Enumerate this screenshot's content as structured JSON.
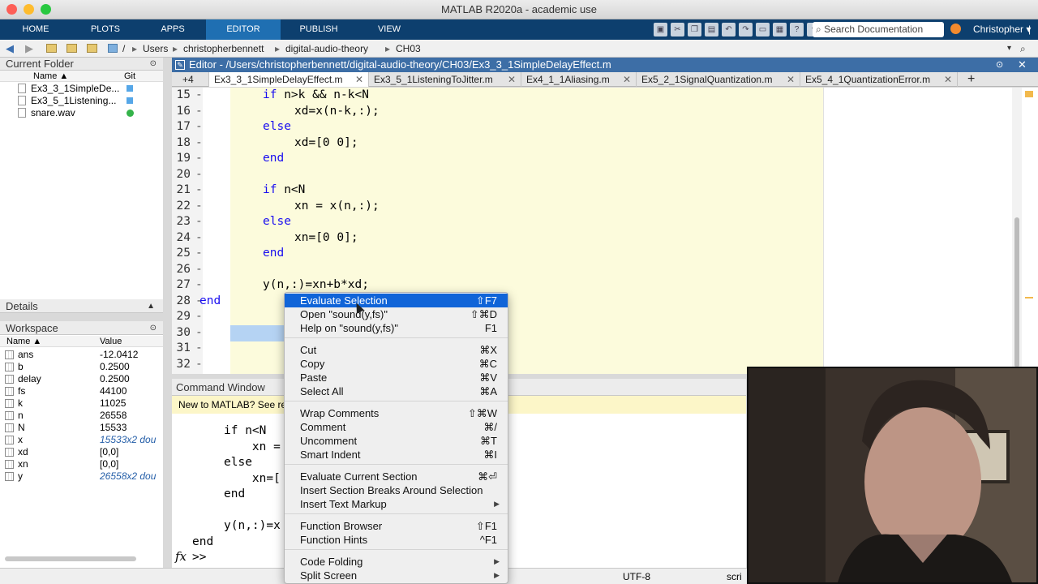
{
  "window": {
    "title": "MATLAB R2020a - academic use"
  },
  "ribbon": {
    "tabs": [
      {
        "label": "HOME"
      },
      {
        "label": "PLOTS"
      },
      {
        "label": "APPS"
      },
      {
        "label": "EDITOR"
      },
      {
        "label": "PUBLISH"
      },
      {
        "label": "VIEW"
      }
    ],
    "search_placeholder": "Search Documentation",
    "user": "Christopher",
    "active_tab": "EDITOR",
    "accent_color": "#0d3f6e"
  },
  "address": {
    "root": "/",
    "crumbs": [
      "Users",
      "christopherbennett",
      "digital-audio-theory",
      "CH03"
    ]
  },
  "current_folder": {
    "title": "Current Folder",
    "col_name": "Name ▲",
    "col_git": "Git",
    "files": [
      {
        "name": "Ex3_3_1SimpleDe..."
      },
      {
        "name": "Ex3_5_1Listening..."
      },
      {
        "name": "snare.wav"
      }
    ]
  },
  "details": {
    "title": "Details"
  },
  "workspace": {
    "title": "Workspace",
    "col_name": "Name ▲",
    "col_value": "Value",
    "vars": [
      {
        "name": "ans",
        "value": "-12.0412"
      },
      {
        "name": "b",
        "value": "0.2500"
      },
      {
        "name": "delay",
        "value": "0.2500"
      },
      {
        "name": "fs",
        "value": "44100"
      },
      {
        "name": "k",
        "value": "11025"
      },
      {
        "name": "n",
        "value": "26558"
      },
      {
        "name": "N",
        "value": "15533"
      },
      {
        "name": "x",
        "value": "15533x2 dou"
      },
      {
        "name": "xd",
        "value": "[0,0]"
      },
      {
        "name": "xn",
        "value": "[0,0]"
      },
      {
        "name": "y",
        "value": "26558x2 dou"
      }
    ]
  },
  "editor": {
    "title": "Editor - /Users/christopherbennett/digital-audio-theory/CH03/Ex3_3_1SimpleDelayEffect.m",
    "overflow": "+4",
    "tabs": [
      {
        "label": "Ex3_3_1SimpleDelayEffect.m"
      },
      {
        "label": "Ex3_5_1ListeningToJitter.m"
      },
      {
        "label": "Ex4_1_1Aliasing.m"
      },
      {
        "label": "Ex5_2_1SignalQuantization.m"
      },
      {
        "label": "Ex5_4_1QuantizationError.m"
      }
    ],
    "add": "+",
    "lines": [
      {
        "n": "15",
        "kw": "if",
        "rest": " n>k && n-k<N"
      },
      {
        "n": "16",
        "kw": "",
        "rest": "xd=x(n-k,:);"
      },
      {
        "n": "17",
        "kw": "else",
        "rest": ""
      },
      {
        "n": "18",
        "kw": "",
        "rest": "xd=[0 0];"
      },
      {
        "n": "19",
        "kw": "end",
        "rest": ""
      },
      {
        "n": "20",
        "kw": "",
        "rest": ""
      },
      {
        "n": "21",
        "kw": "if",
        "rest": " n<N"
      },
      {
        "n": "22",
        "kw": "",
        "rest": "xn = x(n,:);"
      },
      {
        "n": "23",
        "kw": "else",
        "rest": ""
      },
      {
        "n": "24",
        "kw": "",
        "rest": "xn=[0 0];"
      },
      {
        "n": "25",
        "kw": "end",
        "rest": ""
      },
      {
        "n": "26",
        "kw": "",
        "rest": ""
      },
      {
        "n": "27",
        "kw": "",
        "rest": "y(n,:)=xn+b*xd;"
      },
      {
        "n": "28",
        "kw": "end",
        "rest": ""
      },
      {
        "n": "29",
        "kw": "",
        "rest": ""
      },
      {
        "n": "30",
        "kw": "",
        "rest": "sound(y"
      },
      {
        "n": "31",
        "kw": "",
        "rest": ""
      },
      {
        "n": "32",
        "kw": "",
        "rest": ""
      }
    ]
  },
  "command_window": {
    "title": "Command Window",
    "new_msg": "New to MATLAB? See res",
    "lines": [
      "if n<N",
      "    xn =",
      "else",
      "    xn=[",
      "end",
      "",
      "y(n,:)=x",
      "end"
    ],
    "prompt": ">>"
  },
  "status": {
    "encoding": "UTF-8",
    "mode": "scri"
  },
  "context_menu": {
    "items": [
      {
        "label": "Evaluate Selection",
        "shortcut": "⇧F7"
      },
      {
        "label": "Open \"sound(y,fs)\"",
        "shortcut": "⇧⌘D"
      },
      {
        "label": "Help on \"sound(y,fs)\"",
        "shortcut": "F1"
      },
      {
        "label": "Cut",
        "shortcut": "⌘X"
      },
      {
        "label": "Copy",
        "shortcut": "⌘C"
      },
      {
        "label": "Paste",
        "shortcut": "⌘V"
      },
      {
        "label": "Select All",
        "shortcut": "⌘A"
      },
      {
        "label": "Wrap Comments",
        "shortcut": "⇧⌘W"
      },
      {
        "label": "Comment",
        "shortcut": "⌘/"
      },
      {
        "label": "Uncomment",
        "shortcut": "⌘T"
      },
      {
        "label": "Smart Indent",
        "shortcut": "⌘I"
      },
      {
        "label": "Evaluate Current Section",
        "shortcut": "⌘⏎"
      },
      {
        "label": "Insert Section Breaks Around Selection",
        "shortcut": ""
      },
      {
        "label": "Insert Text Markup",
        "shortcut": ""
      },
      {
        "label": "Function Browser",
        "shortcut": "⇧F1"
      },
      {
        "label": "Function Hints",
        "shortcut": "^F1"
      },
      {
        "label": "Code Folding",
        "shortcut": ""
      },
      {
        "label": "Split Screen",
        "shortcut": ""
      }
    ]
  }
}
